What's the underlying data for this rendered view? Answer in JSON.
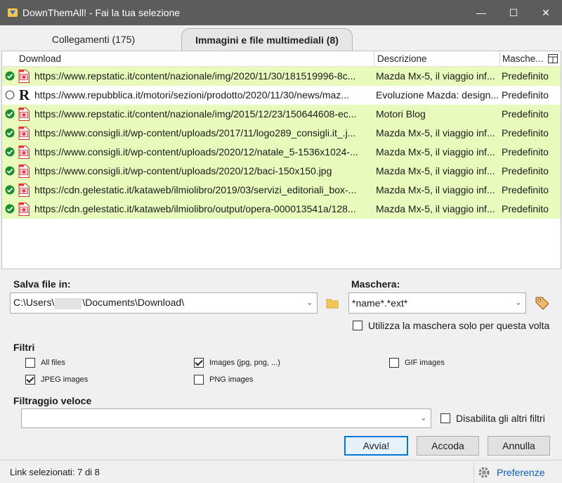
{
  "window": {
    "title": "DownThemAll! - Fai la tua selezione",
    "minimize": "—",
    "maximize": "☐",
    "close": "✕"
  },
  "tabs": [
    {
      "label": "Collegamenti (175)",
      "active": false
    },
    {
      "label": "Immagini e file multimediali (8)",
      "active": true
    }
  ],
  "list": {
    "columns": {
      "download": "Download",
      "descrizione": "Descrizione",
      "maschera": "Masche..."
    },
    "rows": [
      {
        "checked": true,
        "icon": "image-file-icon",
        "url": "https://www.repstatic.it/content/nazionale/img/2020/11/30/181519996-8c...",
        "desc": "Mazda Mx-5, il viaggio inf...",
        "mask": "Predefinito"
      },
      {
        "checked": false,
        "icon": "repubblica-logo",
        "logo_letter": "R",
        "url": "https://www.repubblica.it/motori/sezioni/prodotto/2020/11/30/news/maz...",
        "desc": "Evoluzione Mazda: design...",
        "mask": "Predefinito"
      },
      {
        "checked": true,
        "icon": "image-file-icon",
        "url": "https://www.repstatic.it/content/nazionale/img/2015/12/23/150644608-ec...",
        "desc": "Motori Blog",
        "mask": "Predefinito"
      },
      {
        "checked": true,
        "icon": "image-file-icon",
        "url": "https://www.consigli.it/wp-content/uploads/2017/11/logo289_consigli.it_.j...",
        "desc": "Mazda Mx-5, il viaggio inf...",
        "mask": "Predefinito"
      },
      {
        "checked": true,
        "icon": "image-file-icon",
        "url": "https://www.consigli.it/wp-content/uploads/2020/12/natale_5-1536x1024-...",
        "desc": "Mazda Mx-5, il viaggio inf...",
        "mask": "Predefinito"
      },
      {
        "checked": true,
        "icon": "image-file-icon",
        "url": "https://www.consigli.it/wp-content/uploads/2020/12/baci-150x150.jpg",
        "desc": "Mazda Mx-5, il viaggio inf...",
        "mask": "Predefinito"
      },
      {
        "checked": true,
        "icon": "image-file-icon",
        "url": "https://cdn.gelestatic.it/kataweb/ilmiolibro/2019/03/servizi_editoriali_box-...",
        "desc": "Mazda Mx-5, il viaggio inf...",
        "mask": "Predefinito"
      },
      {
        "checked": true,
        "icon": "image-file-icon",
        "url": "https://cdn.gelestatic.it/kataweb/ilmiolibro/output/opera-000013541a/128...",
        "desc": "Mazda Mx-5, il viaggio inf...",
        "mask": "Predefinito"
      }
    ]
  },
  "save": {
    "label": "Salva file in:",
    "path_prefix": "C:\\Users\\",
    "path_suffix": "\\Documents\\Download\\"
  },
  "mask": {
    "label": "Maschera:",
    "value": "*name*.*ext*",
    "only_this_time": "Utilizza la maschera solo per questa volta",
    "only_this_time_checked": false
  },
  "filters": {
    "label": "Filtri",
    "items": [
      {
        "label": "All files",
        "checked": false
      },
      {
        "label": "Images (jpg, png, ...)",
        "checked": true
      },
      {
        "label": "GIF images",
        "checked": false
      },
      {
        "label": "JPEG images",
        "checked": true
      },
      {
        "label": "PNG images",
        "checked": false
      }
    ]
  },
  "quick_filter": {
    "label": "Filtraggio veloce",
    "value": "",
    "disable_others": "Disabilita gli altri filtri",
    "disable_others_checked": false
  },
  "buttons": {
    "start": "Avvia!",
    "queue": "Accoda",
    "cancel": "Annulla"
  },
  "status": {
    "selected": "Link selezionati: 7 di 8",
    "preferences": "Preferenze"
  },
  "colors": {
    "checked_row": "#e8fbbc",
    "check_green": "#1a8f2e",
    "titlebar": "#5c5c5c",
    "link_blue": "#0a5eb7"
  }
}
